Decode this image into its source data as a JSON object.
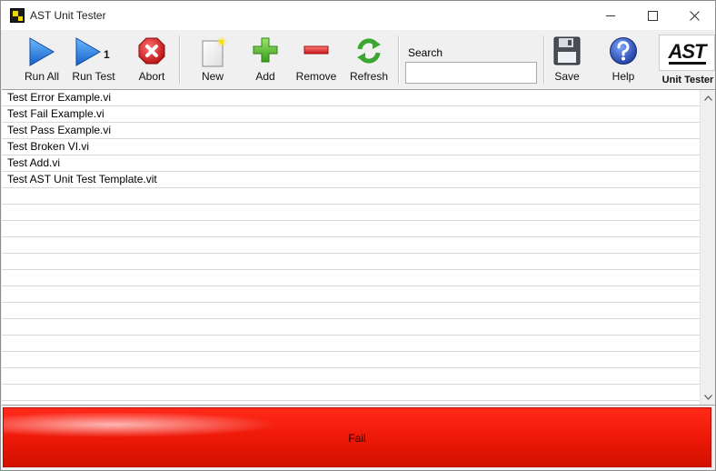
{
  "window": {
    "title": "AST Unit Tester"
  },
  "toolbar": {
    "run_all": "Run All",
    "run_test": "Run Test",
    "run_test_badge": "1",
    "abort": "Abort",
    "new": "New",
    "add": "Add",
    "remove": "Remove",
    "refresh": "Refresh",
    "search_label": "Search",
    "search_value": "",
    "save": "Save",
    "help": "Help"
  },
  "logo": {
    "text": "AST",
    "caption": "Unit Tester"
  },
  "tests": [
    "Test Error Example.vi",
    "Test Fail Example.vi",
    "Test Pass Example.vi",
    "Test Broken VI.vi",
    "Test Add.vi",
    "Test AST Unit Test Template.vit"
  ],
  "status": {
    "text": "Fail",
    "color": "#f01a0a"
  },
  "colors": {
    "run_blue": "#1e7fe0",
    "abort_red": "#d41a1a",
    "add_green": "#4caf2a",
    "remove_red": "#e03030",
    "refresh_green": "#3aa830",
    "help_blue": "#2a4fbf"
  }
}
